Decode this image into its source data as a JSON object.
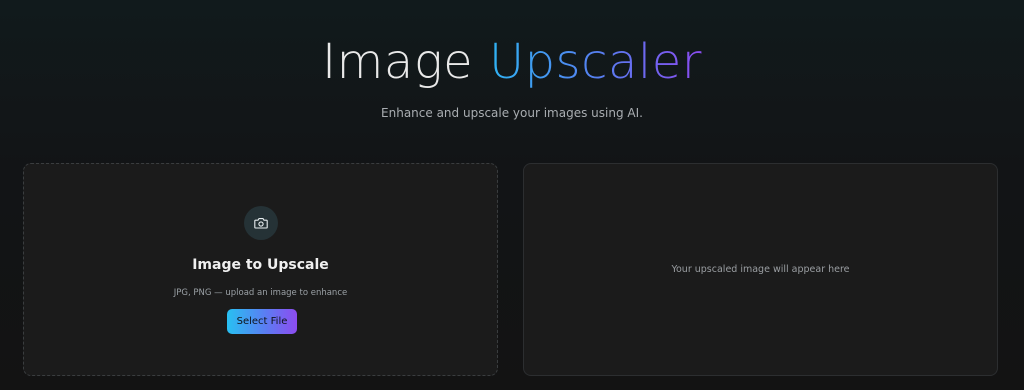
{
  "header": {
    "title_part1": "Image",
    "title_part2": "Upscaler",
    "subtitle": "Enhance and upscale your images using AI."
  },
  "upload_panel": {
    "icon": "camera-icon",
    "title": "Image to Upscale",
    "hint": "JPG, PNG — upload an image to enhance",
    "button_label": "Select File"
  },
  "result_panel": {
    "placeholder": "Your upscaled image will appear here"
  },
  "colors": {
    "background": "#131313",
    "panel": "#1b1b1b",
    "accent_start": "#28c0f2",
    "accent_end": "#8d4cf0"
  }
}
